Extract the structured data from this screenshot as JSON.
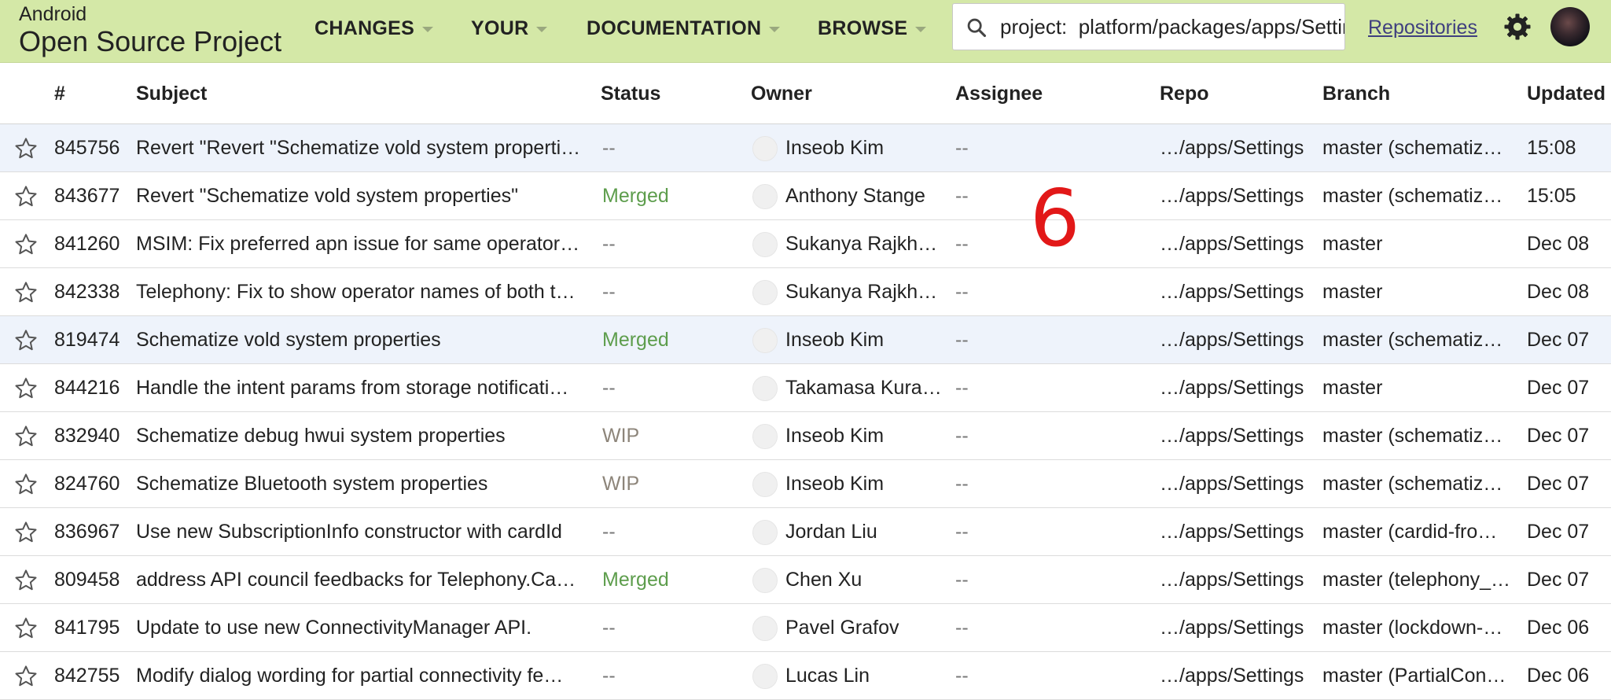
{
  "header": {
    "brand_small": "Android",
    "brand_large": "Open Source Project",
    "menus": [
      "CHANGES",
      "YOUR",
      "DOCUMENTATION",
      "BROWSE"
    ],
    "search_value": "project:  platform/packages/apps/Settings",
    "repositories_link": "Repositories"
  },
  "table": {
    "headers": {
      "number": "#",
      "subject": "Subject",
      "status": "Status",
      "owner": "Owner",
      "assignee": "Assignee",
      "repo": "Repo",
      "branch": "Branch",
      "updated": "Updated"
    },
    "rows": [
      {
        "number": "845756",
        "subject": "Revert \"Revert \"Schematize vold system properti…",
        "status": "--",
        "owner": "Inseob Kim",
        "assignee": "--",
        "repo": "…/apps/Settings",
        "branch": "master (schematiz…",
        "updated": "15:08"
      },
      {
        "number": "843677",
        "subject": "Revert \"Schematize vold system properties\"",
        "status": "Merged",
        "owner": "Anthony Stange",
        "assignee": "--",
        "repo": "…/apps/Settings",
        "branch": "master (schematiz…",
        "updated": "15:05"
      },
      {
        "number": "841260",
        "subject": "MSIM: Fix preferred apn issue for same operator…",
        "status": "--",
        "owner": "Sukanya Rajkh…",
        "assignee": "--",
        "repo": "…/apps/Settings",
        "branch": "master",
        "updated": "Dec 08"
      },
      {
        "number": "842338",
        "subject": "Telephony: Fix to show operator names of both t…",
        "status": "--",
        "owner": "Sukanya Rajkh…",
        "assignee": "--",
        "repo": "…/apps/Settings",
        "branch": "master",
        "updated": "Dec 08"
      },
      {
        "number": "819474",
        "subject": "Schematize vold system properties",
        "status": "Merged",
        "owner": "Inseob Kim",
        "assignee": "--",
        "repo": "…/apps/Settings",
        "branch": "master (schematiz…",
        "updated": "Dec 07"
      },
      {
        "number": "844216",
        "subject": "Handle the intent params from storage notificati…",
        "status": "--",
        "owner": "Takamasa Kura…",
        "assignee": "--",
        "repo": "…/apps/Settings",
        "branch": "master",
        "updated": "Dec 07"
      },
      {
        "number": "832940",
        "subject": "Schematize debug hwui system properties",
        "status": "WIP",
        "owner": "Inseob Kim",
        "assignee": "--",
        "repo": "…/apps/Settings",
        "branch": "master (schematiz…",
        "updated": "Dec 07"
      },
      {
        "number": "824760",
        "subject": "Schematize Bluetooth system properties",
        "status": "WIP",
        "owner": "Inseob Kim",
        "assignee": "--",
        "repo": "…/apps/Settings",
        "branch": "master (schematiz…",
        "updated": "Dec 07"
      },
      {
        "number": "836967",
        "subject": "Use new SubscriptionInfo constructor with cardId",
        "status": "--",
        "owner": "Jordan Liu",
        "assignee": "--",
        "repo": "…/apps/Settings",
        "branch": "master (cardid-fro…",
        "updated": "Dec 07"
      },
      {
        "number": "809458",
        "subject": "address API council feedbacks for Telephony.Ca…",
        "status": "Merged",
        "owner": "Chen Xu",
        "assignee": "--",
        "repo": "…/apps/Settings",
        "branch": "master (telephony_…",
        "updated": "Dec 07"
      },
      {
        "number": "841795",
        "subject": "Update to use new ConnectivityManager API.",
        "status": "--",
        "owner": "Pavel Grafov",
        "assignee": "--",
        "repo": "…/apps/Settings",
        "branch": "master (lockdown-…",
        "updated": "Dec 06"
      },
      {
        "number": "842755",
        "subject": "Modify dialog wording for partial connectivity fe…",
        "status": "--",
        "owner": "Lucas Lin",
        "assignee": "--",
        "repo": "…/apps/Settings",
        "branch": "master (PartialCon…",
        "updated": "Dec 06"
      }
    ]
  },
  "overlay_label": "6",
  "colors": {
    "header_bg": "#d4e8a7",
    "merged": "#5d9d4c",
    "wip": "#8d857a",
    "highlight_row": "#eef3fb",
    "overlay": "#e21818"
  }
}
